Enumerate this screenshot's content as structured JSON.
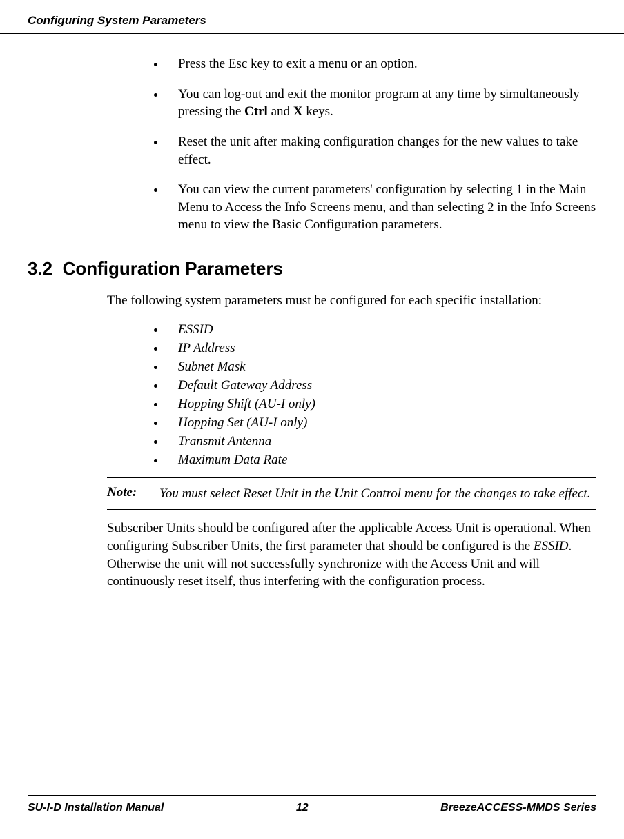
{
  "header": {
    "title": "Configuring System Parameters"
  },
  "bullets_top": [
    "Press the Esc key to exit a menu or an option.",
    "You can log-out and exit the monitor program at any time by simultaneously pressing the <b>Ctrl</b> and <b>X</b> keys.",
    "Reset the unit after making configuration changes for the new values to take effect.",
    "You can view the current parameters' configuration by selecting 1 in the Main Menu to Access the Info Screens menu, and than selecting 2 in the Info Screens menu to view the Basic Configuration parameters."
  ],
  "section": {
    "number": "3.2",
    "title": "Configuration Parameters"
  },
  "intro": "The following system parameters must be configured for each specific installation:",
  "params": [
    "ESSID",
    "IP Address",
    "Subnet Mask",
    "Default Gateway Address",
    "Hopping Shift (AU-I only)",
    "Hopping Set (AU-I only)",
    "Transmit Antenna",
    "Maximum Data Rate"
  ],
  "note": {
    "label": "Note:",
    "text": "You must select Reset Unit in the Unit Control menu for the changes to take effect."
  },
  "body": "Subscriber Units should be configured after the applicable Access Unit is operational. When configuring Subscriber Units, the first parameter that should be configured is the <i>ESSID</i>. Otherwise the unit will not successfully synchronize with the Access Unit and will continuously reset itself, thus interfering with the configuration process.",
  "footer": {
    "left": "SU-I-D Installation Manual",
    "center": "12",
    "right": "BreezeACCESS-MMDS Series"
  }
}
